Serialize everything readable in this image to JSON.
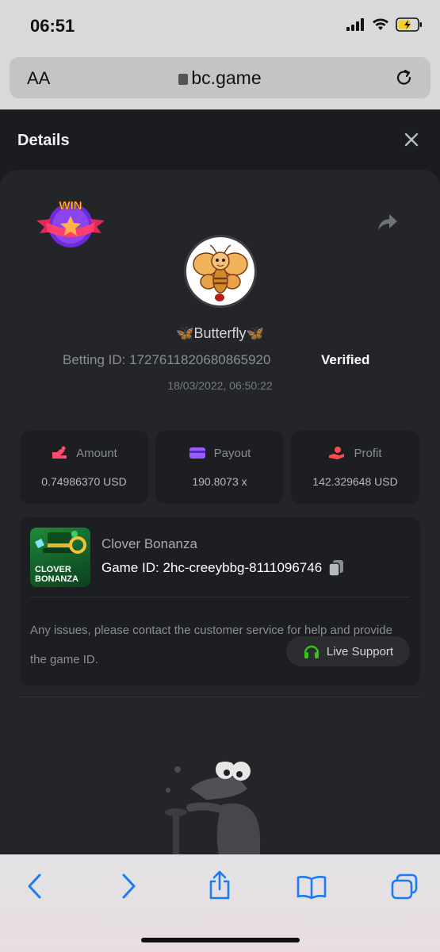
{
  "status": {
    "time": "06:51"
  },
  "browser": {
    "aa_label": "AA",
    "url": "bc.game"
  },
  "sheet": {
    "title": "Details"
  },
  "bet": {
    "username": "Butterfly",
    "betting_id_label": "Betting ID: 1727611820680865920",
    "verified": "Verified",
    "date": "18/03/2022, 06:50:22"
  },
  "stats": [
    {
      "label": "Amount",
      "value": "0.74986370 USD",
      "icon_color": "#ff4b6e"
    },
    {
      "label": "Payout",
      "value": "190.8073 x",
      "icon_color": "#9b5cff"
    },
    {
      "label": "Profit",
      "value": "142.329648 USD",
      "icon_color": "#ff4b4b"
    }
  ],
  "game": {
    "name": "Clover Bonanza",
    "game_id_label": "Game ID:",
    "game_id": "2hc-creeybbg-8111096746",
    "thumb_text_1": "CLOVER",
    "thumb_text_2": "BONANZA",
    "help_text": "Any issues, please contact the customer service for help and provide the game ID.",
    "live_support": "Live Support"
  },
  "badge": {
    "text": "WIN"
  },
  "colors": {
    "accent_green": "#3bc117",
    "verified": "#ffffff",
    "ios_blue": "#1a7cf5"
  }
}
